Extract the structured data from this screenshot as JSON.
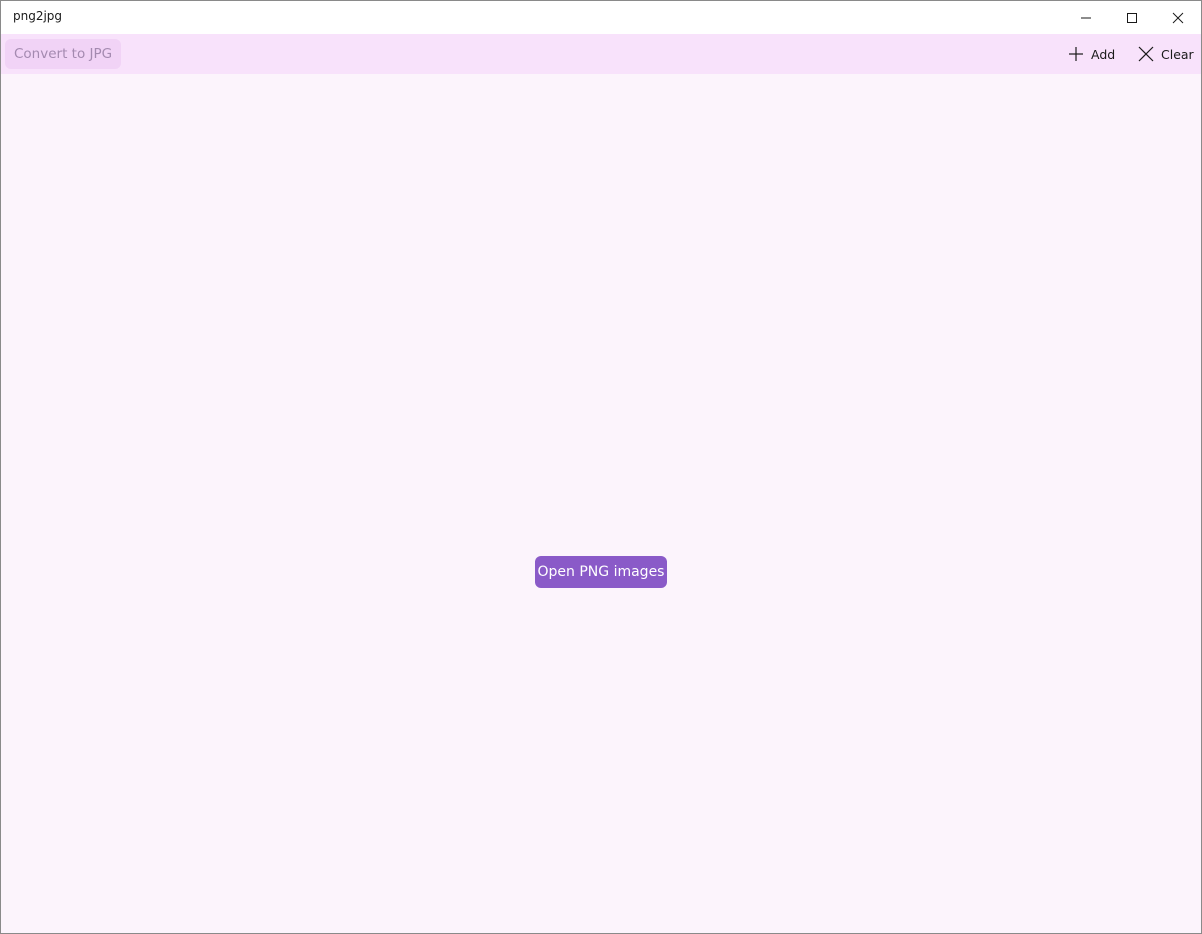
{
  "window": {
    "title": "png2jpg",
    "controls": {
      "minimize_icon": "minimize-icon",
      "maximize_icon": "maximize-icon",
      "close_icon": "close-icon"
    }
  },
  "toolbar": {
    "convert_label": "Convert to JPG",
    "add_label": "Add",
    "add_icon": "plus-icon",
    "clear_label": "Clear",
    "clear_icon": "x-icon"
  },
  "main": {
    "open_button_label": "Open PNG images"
  },
  "colors": {
    "toolbar_bg": "#f8e2fb",
    "content_bg": "#fcf4fc",
    "accent": "#8a5ac8",
    "disabled_text": "#a48ab0"
  }
}
